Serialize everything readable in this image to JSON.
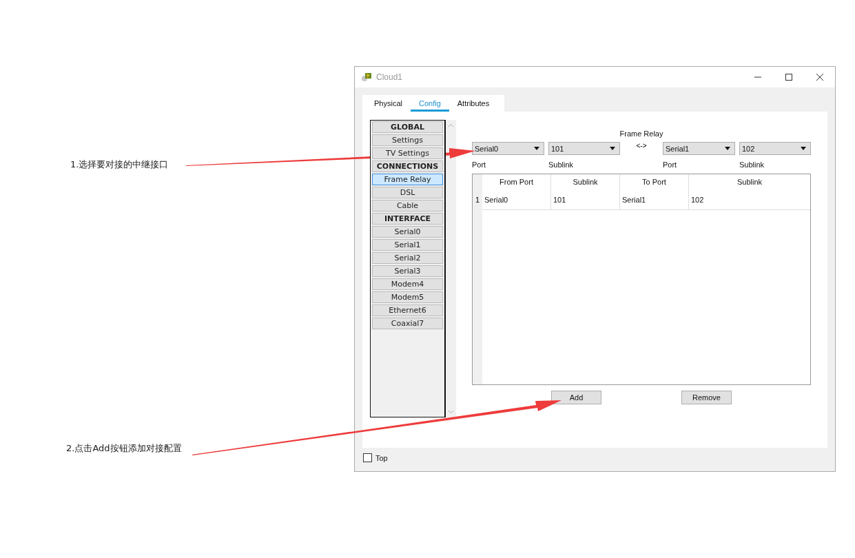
{
  "annotations": [
    {
      "text": "1.选择要对接的中继接口"
    },
    {
      "text": "2.点击Add按钮添加对接配置"
    }
  ],
  "window": {
    "title": "Cloud1"
  },
  "tabs": [
    {
      "label": "Physical",
      "selected": false
    },
    {
      "label": "Config",
      "selected": true
    },
    {
      "label": "Attributes",
      "selected": false
    }
  ],
  "sidebar": {
    "items": [
      {
        "label": "GLOBAL",
        "kind": "header",
        "selected": false
      },
      {
        "label": "Settings",
        "kind": "item",
        "selected": false
      },
      {
        "label": "TV Settings",
        "kind": "item",
        "selected": false
      },
      {
        "label": "CONNECTIONS",
        "kind": "header",
        "selected": false
      },
      {
        "label": "Frame Relay",
        "kind": "item",
        "selected": true
      },
      {
        "label": "DSL",
        "kind": "item",
        "selected": false
      },
      {
        "label": "Cable",
        "kind": "item",
        "selected": false
      },
      {
        "label": "INTERFACE",
        "kind": "header",
        "selected": false
      },
      {
        "label": "Serial0",
        "kind": "item",
        "selected": false
      },
      {
        "label": "Serial1",
        "kind": "item",
        "selected": false
      },
      {
        "label": "Serial2",
        "kind": "item",
        "selected": false
      },
      {
        "label": "Serial3",
        "kind": "item",
        "selected": false
      },
      {
        "label": "Modem4",
        "kind": "item",
        "selected": false
      },
      {
        "label": "Modem5",
        "kind": "item",
        "selected": false
      },
      {
        "label": "Ethernet6",
        "kind": "item",
        "selected": false
      },
      {
        "label": "Coaxial7",
        "kind": "item",
        "selected": false
      }
    ]
  },
  "frame_relay": {
    "title": "Frame Relay",
    "link_symbol": "<->",
    "selectors": [
      {
        "value": "Serial0",
        "label": "Port"
      },
      {
        "value": "101",
        "label": "Sublink"
      },
      {
        "value": "Serial1",
        "label": "Port"
      },
      {
        "value": "102",
        "label": "Sublink"
      }
    ]
  },
  "table": {
    "columns": [
      "From Port",
      "Sublink",
      "To Port",
      "Sublink"
    ],
    "rows": [
      {
        "number": "1",
        "cells": [
          "Serial0",
          "101",
          "Serial1",
          "102"
        ]
      }
    ]
  },
  "buttons": [
    "Add",
    "Remove"
  ],
  "top_checkbox": {
    "label": "Top",
    "checked": false
  }
}
